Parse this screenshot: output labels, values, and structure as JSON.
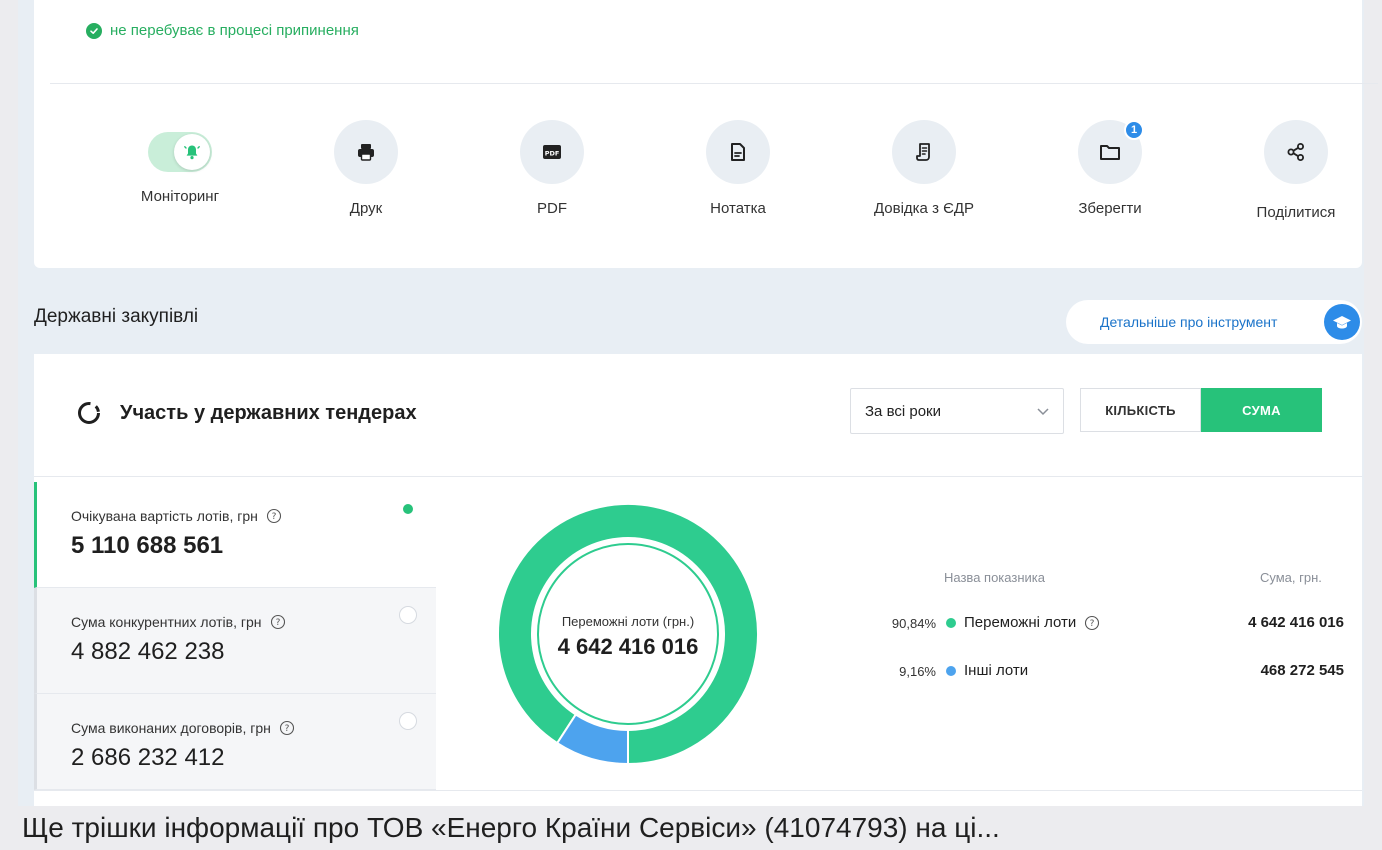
{
  "status": {
    "text": "не перебуває в процесі припинення",
    "color": "#27ae60"
  },
  "actions": [
    {
      "name": "monitoring",
      "label": "Моніторинг",
      "icon": "bell-icon"
    },
    {
      "name": "print",
      "label": "Друк",
      "icon": "printer-icon"
    },
    {
      "name": "pdf",
      "label": "PDF",
      "icon": "pdf-icon"
    },
    {
      "name": "note",
      "label": "Нотатка",
      "icon": "note-icon"
    },
    {
      "name": "edr",
      "label": "Довідка з ЄДР",
      "icon": "document-icon"
    },
    {
      "name": "save",
      "label": "Зберегти",
      "icon": "folder-icon",
      "badge": "1"
    },
    {
      "name": "share",
      "label": "Поділитися",
      "icon": "share-icon"
    }
  ],
  "section": {
    "title": "Державні закупівлі",
    "more_label": "Детальніше про інструмент"
  },
  "card": {
    "title": "Участь у державних тендерах",
    "period_select": "За всі роки",
    "toggle_count": "КІЛЬКІСТЬ",
    "toggle_sum": "СУМА"
  },
  "metrics": [
    {
      "label": "Очікувана вартість лотів, грн",
      "value": "5 110 688 561",
      "selected": true
    },
    {
      "label": "Сума конкурентних лотів, грн",
      "value": "4 882 462 238",
      "selected": false
    },
    {
      "label": "Сума виконаних договорів, грн",
      "value": "2 686 232 412",
      "selected": false
    }
  ],
  "chart_data": {
    "type": "pie",
    "center_label": "Переможні лоти (грн.)",
    "center_value": "4 642 416 016",
    "legend_header_name": "Назва показника",
    "legend_header_sum": "Сума, грн.",
    "slices": [
      {
        "name": "Переможні лоти",
        "percent_label": "90,84%",
        "percent": 90.84,
        "value_label": "4 642 416 016",
        "value": 4642416016,
        "color": "#2ecc8f"
      },
      {
        "name": "Інші лоти",
        "percent_label": "9,16%",
        "percent": 9.16,
        "value_label": "468 272 545",
        "value": 468272545,
        "color": "#4da3ee"
      }
    ]
  },
  "footer": {
    "text": "Ще трішки інформації про ТОВ «Енерго Країни Сервіси» (41074793) на ці..."
  },
  "colors": {
    "accent_green": "#27c27a",
    "accent_blue": "#2d8ce8"
  }
}
